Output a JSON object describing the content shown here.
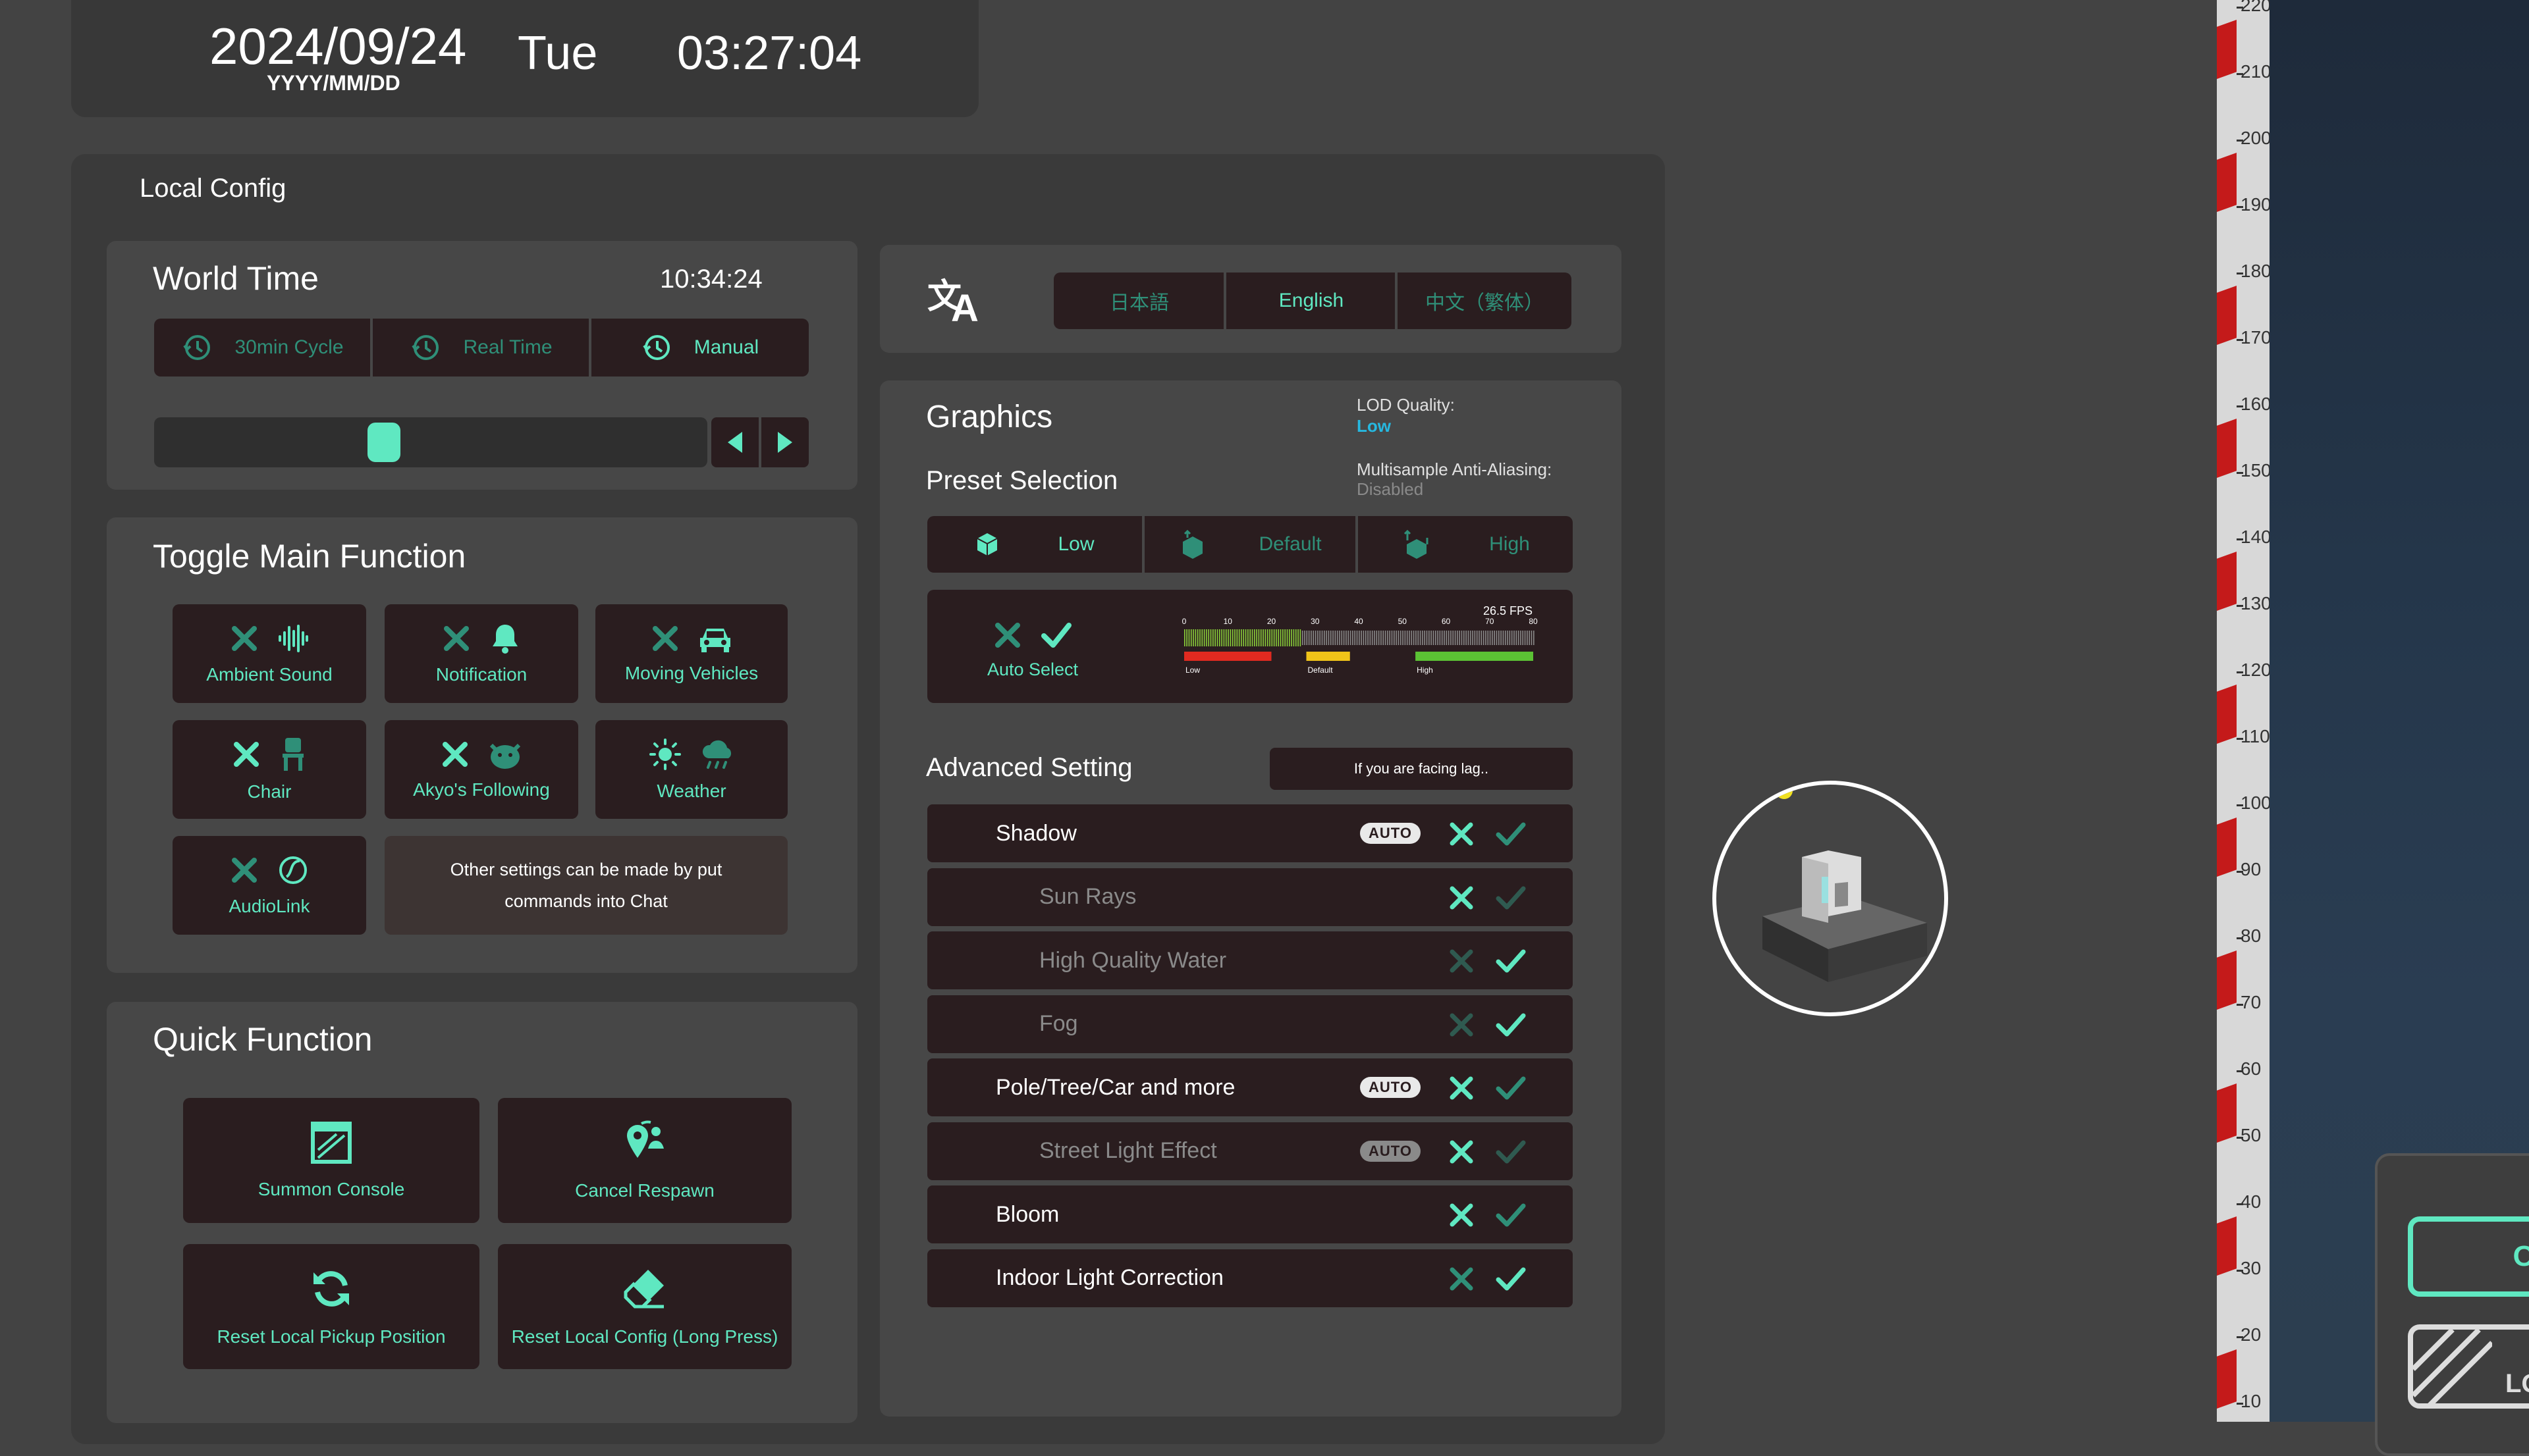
{
  "datetime": {
    "date": "2024/09/24",
    "format": "YYYY/MM/DD",
    "weekday": "Tue",
    "time": "03:27:04"
  },
  "local_config": {
    "title": "Local Config",
    "world_time": {
      "title": "World Time",
      "clock": "10:34:24",
      "modes": [
        "30min Cycle",
        "Real Time",
        "Manual"
      ],
      "selected_mode": "Manual",
      "slider_level": 0.41
    },
    "toggle_main": {
      "title": "Toggle Main Function",
      "items": [
        {
          "label": "Ambient Sound",
          "icon": "soundwave-icon",
          "state": "off"
        },
        {
          "label": "Notification",
          "icon": "bell-icon",
          "state": "off"
        },
        {
          "label": "Moving Vehicles",
          "icon": "car-icon",
          "state": "off"
        },
        {
          "label": "Chair",
          "icon": "chair-icon",
          "state": "off"
        },
        {
          "label": "Akyo's Following",
          "icon": "akyo-icon",
          "state": "off"
        },
        {
          "label": "Weather",
          "icon": "weather-icon",
          "state": "sun"
        },
        {
          "label": "AudioLink",
          "icon": "audiolink-icon",
          "state": "off"
        }
      ],
      "note": "Other settings can be made by put commands into Chat"
    },
    "quick_function": {
      "title": "Quick Function",
      "buttons": [
        {
          "label": "Summon Console",
          "icon": "console-icon"
        },
        {
          "label": "Cancel Respawn",
          "icon": "respawn-pin-icon"
        },
        {
          "label": "Reset Local Pickup Position",
          "icon": "refresh-icon"
        },
        {
          "label": "Reset Local Config (Long Press)",
          "icon": "eraser-icon"
        }
      ]
    }
  },
  "language": {
    "icon": "translate-icon",
    "options": [
      "日本語",
      "English",
      "中文（繁体）"
    ],
    "selected": "English"
  },
  "graphics": {
    "title": "Graphics",
    "lod_label": "LOD Quality:",
    "lod_value": "Low",
    "msaa_label": "Multisample Anti-Aliasing:",
    "msaa_value": "Disabled",
    "preset_title": "Preset Selection",
    "presets": [
      "Low",
      "Default",
      "High"
    ],
    "selected_preset": "Low",
    "auto_select": "Auto Select",
    "fps_label": "26.5 FPS",
    "fps_ticks": [
      "0",
      "10",
      "20",
      "30",
      "40",
      "50",
      "60",
      "70",
      "80"
    ],
    "fps_zones": [
      "Low",
      "Default",
      "High"
    ],
    "fps_value": 26.5,
    "advanced_title": "Advanced Setting",
    "lag_hint": "If you are facing lag..",
    "auto_badge": "AUTO",
    "settings": [
      {
        "name": "Shadow",
        "auto": true,
        "enabled": true,
        "state": "x"
      },
      {
        "name": "Sun Rays",
        "auto": false,
        "enabled": false,
        "state": "x"
      },
      {
        "name": "High Quality Water",
        "auto": false,
        "enabled": false,
        "state": "check"
      },
      {
        "name": "Fog",
        "auto": false,
        "enabled": false,
        "state": "check"
      },
      {
        "name": "Pole/Tree/Car and more",
        "auto": true,
        "enabled": true,
        "state": "x"
      },
      {
        "name": "Street Light Effect",
        "auto": true,
        "enabled": false,
        "state": "x"
      },
      {
        "name": "Bloom",
        "auto": false,
        "enabled": true,
        "state": "x"
      },
      {
        "name": "Indoor Light Correction",
        "auto": false,
        "enabled": true,
        "state": "check"
      }
    ]
  },
  "ruler": {
    "labels": [
      "220",
      "210",
      "200",
      "190",
      "180",
      "170",
      "160",
      "150",
      "140",
      "130",
      "120",
      "110",
      "100",
      "90",
      "80",
      "70",
      "60",
      "50",
      "40",
      "30",
      "20",
      "10"
    ]
  },
  "bottom_right": {
    "toggle_text": "OF",
    "lq_text": "LQ"
  },
  "colors": {
    "accent": "#5fe8c1",
    "panel": "#3a3a3a",
    "tile": "#2a1d1f",
    "red_zone": "#e02a20",
    "yellow_zone": "#f0c419",
    "green_zone": "#5bc234",
    "ruler_red": "#c41a1a"
  }
}
